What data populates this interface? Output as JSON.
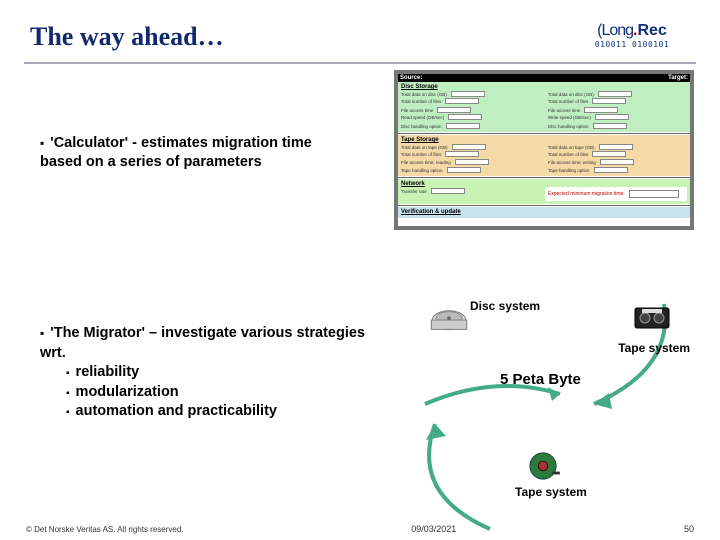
{
  "header": {
    "title": "The way ahead…",
    "logo_text": "Long.Rec",
    "logo_bits": "010011 0100101"
  },
  "bullets": {
    "calc_intro": "'Calculator' - estimates migration time based on a series of parameters",
    "migrator_intro": "'The Migrator' – investigate various strategies wrt.",
    "sub1": "reliability",
    "sub2": "modularization",
    "sub3": "automation and practicability"
  },
  "calc": {
    "col_source": "Source:",
    "col_target": "Target:",
    "sec_disc": "Disc Storage",
    "sec_tape": "Tape Storage",
    "sec_net": "Network",
    "sec_ver": "Verification & update",
    "eq_label": "Expected minimum migration time:"
  },
  "cycle": {
    "disc": "Disc system",
    "tape": "Tape system",
    "center": "5 Peta Byte"
  },
  "footer": {
    "copyright": "© Det Norske Veritas AS. All rights reserved.",
    "date": "09/03/2021",
    "page": "50"
  }
}
